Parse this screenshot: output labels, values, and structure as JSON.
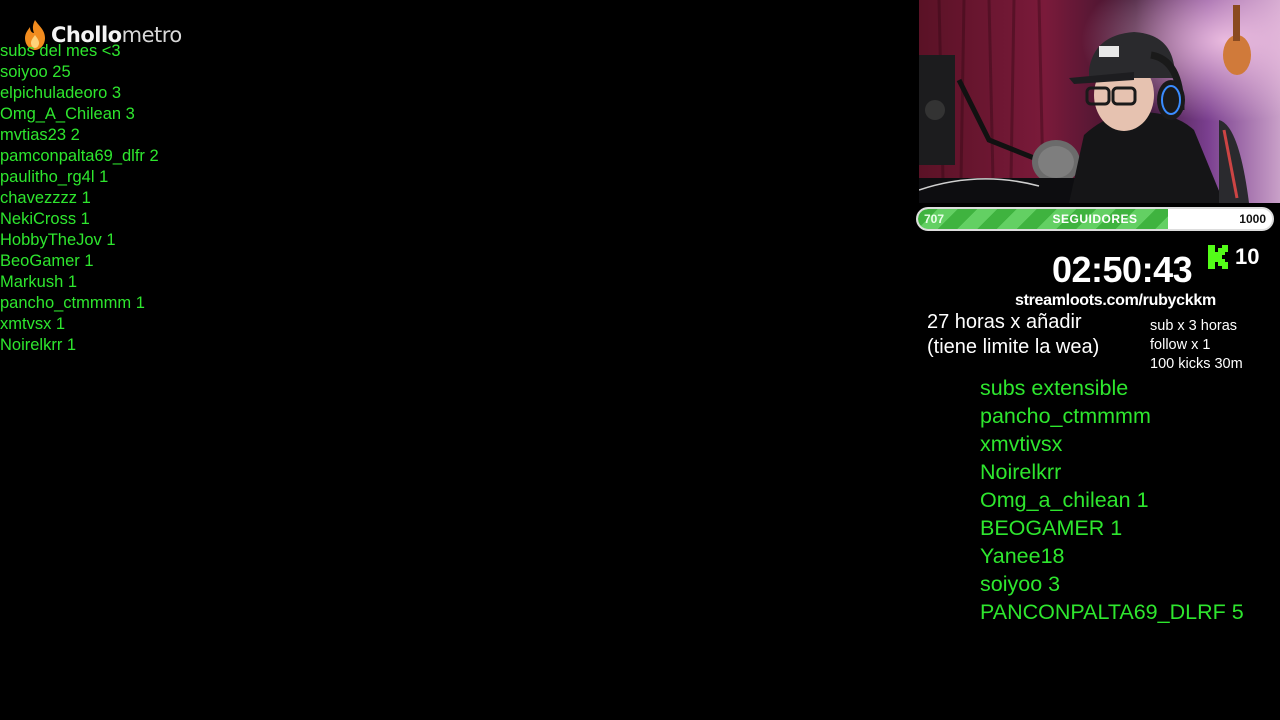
{
  "logo": {
    "brand_bold": "Chollo",
    "brand_light": "metro",
    "icon": "flame-icon",
    "color": "#f28c1e"
  },
  "subs_month": {
    "title": "subs del mes <3",
    "entries": [
      "soiyoo 25",
      "elpichuladeoro 3",
      "Omg_A_Chilean 3",
      "mvtias23 2",
      "pamconpalta69_dlfr 2",
      "paulitho_rg4l 1",
      "chavezzzz 1",
      "NekiCross 1",
      "HobbyTheJov 1",
      "BeoGamer 1",
      "Markush 1",
      "pancho_ctmmmm 1",
      "xmtvsx 1",
      "Noirelkrr 1"
    ]
  },
  "followers_goal": {
    "current": "707",
    "label": "SEGUIDORES",
    "target": "1000",
    "progress_fraction": 0.707,
    "color": "#4fc24f"
  },
  "timer": {
    "value": "02:50:43"
  },
  "kicks": {
    "icon": "kick-logo-icon",
    "count": "10",
    "color": "#53fc18"
  },
  "streamloots": {
    "link": "streamloots.com/rubyckkm"
  },
  "hours_note": {
    "line1": "27 horas x añadir",
    "line2": "(tiene limite la wea)"
  },
  "rules": {
    "line1": "sub x 3 horas",
    "line2": "follow x 1",
    "line3": "100 kicks 30m"
  },
  "subs_extensible": {
    "title": "subs extensible",
    "entries": [
      "pancho_ctmmmm",
      "xmvtivsx",
      "Noirelkrr",
      "Omg_a_chilean 1",
      "BEOGAMER 1",
      "Yanee18",
      "soiyoo 3",
      "PANCONPALTA69_DLRF 5"
    ]
  },
  "webcam": {
    "subject": "streamer-webcam"
  },
  "colors": {
    "list_green": "#2ee62e",
    "background": "#000000"
  }
}
